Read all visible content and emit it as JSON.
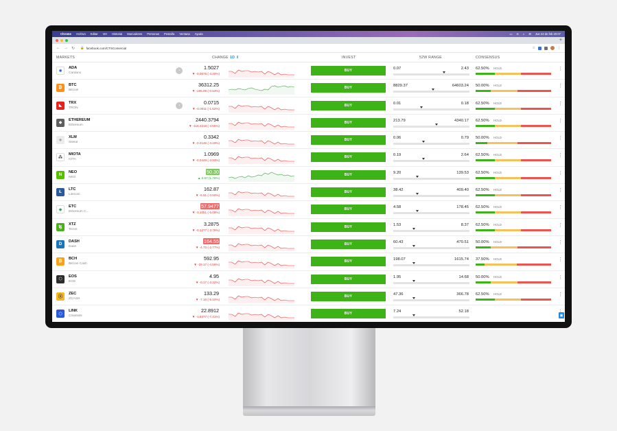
{
  "menubar": {
    "items": [
      "Chrome",
      "Archivo",
      "Editar",
      "Ver",
      "Historial",
      "Marcadores",
      "Personas",
      "Pestaña",
      "Ventana",
      "Ayuda"
    ],
    "datetime": "Jue 23 de feb 20:07"
  },
  "browser": {
    "url": "facebook.com/CTSComercial",
    "new_tab": "+"
  },
  "table": {
    "headers": {
      "markets": "MARKETS",
      "change": "CHANGE",
      "period": "1D ⇕",
      "invest": "INVEST",
      "range": "52W RANGE",
      "consensus": "CONSENSUS"
    },
    "buy_label": "BUY",
    "hold_label": "HOLD",
    "rows": [
      {
        "symbol": "ADA",
        "name": "Cardano",
        "price": "1.5027",
        "change": "▼ -0.0676 (-4.30%)",
        "direction": "down",
        "alert": true,
        "low": "0.07",
        "high": "2.43",
        "range_pos": 0.65,
        "consensus": "62.50%",
        "cons_green": 0.25,
        "icon_color": "#ffffff",
        "icon_glyph": "✺",
        "icon_fg": "#2a5ad6",
        "trend": "down",
        "highlight": ""
      },
      {
        "symbol": "BTC",
        "name": "Bitcoin",
        "price": "36312.25",
        "change": "▼ -195.08 (-0.53%)",
        "direction": "down",
        "alert": false,
        "low": "8829.37",
        "high": "64603.24",
        "range_pos": 0.5,
        "consensus": "50.00%",
        "cons_green": 0.2,
        "icon_color": "#f7931a",
        "icon_glyph": "₿",
        "icon_fg": "#ffffff",
        "trend": "up",
        "highlight": ""
      },
      {
        "symbol": "TRX",
        "name": "TRON",
        "price": "0.0715",
        "change": "▼ -0.0011 (-1.52%)",
        "direction": "down",
        "alert": true,
        "low": "0.01",
        "high": "0.18",
        "range_pos": 0.35,
        "consensus": "62.50%",
        "cons_green": 0.25,
        "icon_color": "#e5231e",
        "icon_glyph": "◣",
        "icon_fg": "#ffffff",
        "trend": "down",
        "highlight": ""
      },
      {
        "symbol": "ETHEREUM",
        "name": "Ethereum",
        "price": "2440.3794",
        "change": "▼ -116.2218 (-4.55%)",
        "direction": "down",
        "alert": false,
        "low": "213.79",
        "high": "4340.17",
        "range_pos": 0.55,
        "consensus": "62.50%",
        "cons_green": 0.25,
        "icon_color": "#5f5f5f",
        "icon_glyph": "◆",
        "icon_fg": "#ffffff",
        "trend": "down",
        "highlight": ""
      },
      {
        "symbol": "XLM",
        "name": "Stellar",
        "price": "0.3342",
        "change": "▼ -0.0146 (-4.19%)",
        "direction": "down",
        "alert": false,
        "low": "0.06",
        "high": "0.79",
        "range_pos": 0.38,
        "consensus": "50.00%",
        "cons_green": 0.15,
        "icon_color": "#ececec",
        "icon_glyph": "✧",
        "icon_fg": "#222222",
        "trend": "down",
        "highlight": ""
      },
      {
        "symbol": "MIOTA",
        "name": "IOTA",
        "price": "1.0969",
        "change": "▼ -0.0449 (-3.93%)",
        "direction": "down",
        "alert": false,
        "low": "0.19",
        "high": "2.64",
        "range_pos": 0.38,
        "consensus": "62.50%",
        "cons_green": 0.25,
        "icon_color": "#ffffff",
        "icon_glyph": "⁂",
        "icon_fg": "#333333",
        "trend": "down",
        "highlight": ""
      },
      {
        "symbol": "NEO",
        "name": "NEO",
        "price": "50.30",
        "change": "▲ 0.87 (1.76%)",
        "direction": "up",
        "alert": false,
        "low": "9.20",
        "high": "139.53",
        "range_pos": 0.3,
        "consensus": "62.50%",
        "cons_green": 0.25,
        "icon_color": "#58bf00",
        "icon_glyph": "N",
        "icon_fg": "#ffffff",
        "trend": "up",
        "highlight": "up"
      },
      {
        "symbol": "LTC",
        "name": "Litecoin",
        "price": "162.87",
        "change": "▼ -5.91 (-3.50%)",
        "direction": "down",
        "alert": false,
        "low": "38.42",
        "high": "409.40",
        "range_pos": 0.3,
        "consensus": "62.50%",
        "cons_green": 0.25,
        "icon_color": "#2a5a9c",
        "icon_glyph": "Ł",
        "icon_fg": "#ffffff",
        "trend": "down",
        "highlight": ""
      },
      {
        "symbol": "ETC",
        "name": "Ethereum C...",
        "price": "57.9477",
        "change": "▼ -3.1051 (-5.09%)",
        "direction": "down",
        "alert": false,
        "low": "4.58",
        "high": "178.45",
        "range_pos": 0.3,
        "consensus": "62.50%",
        "cons_green": 0.25,
        "icon_color": "#ffffff",
        "icon_glyph": "◆",
        "icon_fg": "#33a26a",
        "trend": "down",
        "highlight": "down"
      },
      {
        "symbol": "XTZ",
        "name": "Tezos",
        "price": "3.2875",
        "change": "▼ -0.1277 (-3.76%)",
        "direction": "down",
        "alert": false,
        "low": "1.53",
        "high": "8.37",
        "range_pos": 0.25,
        "consensus": "62.50%",
        "cons_green": 0.25,
        "icon_color": "#4caf20",
        "icon_glyph": "ꜩ",
        "icon_fg": "#ffffff",
        "trend": "down",
        "highlight": ""
      },
      {
        "symbol": "DASH",
        "name": "Dash",
        "price": "164.55",
        "change": "▼ -4.73 (-2.77%)",
        "direction": "down",
        "alert": false,
        "low": "60.43",
        "high": "470.51",
        "range_pos": 0.25,
        "consensus": "50.00%",
        "cons_green": 0.2,
        "icon_color": "#1c75bc",
        "icon_glyph": "D",
        "icon_fg": "#ffffff",
        "trend": "down",
        "highlight": "down"
      },
      {
        "symbol": "BCH",
        "name": "Bitcoin Cash",
        "price": "592.95",
        "change": "▼ -29.17 (-4.56%)",
        "direction": "down",
        "alert": false,
        "low": "198.07",
        "high": "1615.74",
        "range_pos": 0.25,
        "consensus": "37.50%",
        "cons_green": 0.12,
        "icon_color": "#f7a21b",
        "icon_glyph": "₿",
        "icon_fg": "#ffffff",
        "trend": "down",
        "highlight": ""
      },
      {
        "symbol": "EOS",
        "name": "EOS",
        "price": "4.95",
        "change": "▼ -0.17 (-3.32%)",
        "direction": "down",
        "alert": false,
        "low": "1.95",
        "high": "14.68",
        "range_pos": 0.25,
        "consensus": "50.00%",
        "cons_green": 0.2,
        "icon_color": "#2c2c2c",
        "icon_glyph": "⬡",
        "icon_fg": "#ffffff",
        "trend": "down",
        "highlight": ""
      },
      {
        "symbol": "ZEC",
        "name": "ZCASH",
        "price": "133.29",
        "change": "▼ -7.16 (-5.10%)",
        "direction": "down",
        "alert": false,
        "low": "47.36",
        "high": "366.78",
        "range_pos": 0.25,
        "consensus": "62.50%",
        "cons_green": 0.25,
        "icon_color": "#f4b728",
        "icon_glyph": "ⓩ",
        "icon_fg": "#222222",
        "trend": "down",
        "highlight": ""
      },
      {
        "symbol": "LINK",
        "name": "Chainlink",
        "price": "22.8912",
        "change": "▼ -1.8377 (-7.41%)",
        "direction": "down",
        "alert": false,
        "low": "7.24",
        "high": "52.18",
        "range_pos": 0.25,
        "consensus": "",
        "cons_green": 0,
        "icon_color": "#2a5ada",
        "icon_glyph": "⬡",
        "icon_fg": "#ffffff",
        "trend": "down",
        "highlight": ""
      }
    ]
  },
  "colors": {
    "buy": "#3eb318",
    "down": "#e53935",
    "up": "#43a047",
    "cons_green": "#3eb318",
    "cons_yellow": "#f5c15a",
    "cons_red": "#ef5350"
  }
}
